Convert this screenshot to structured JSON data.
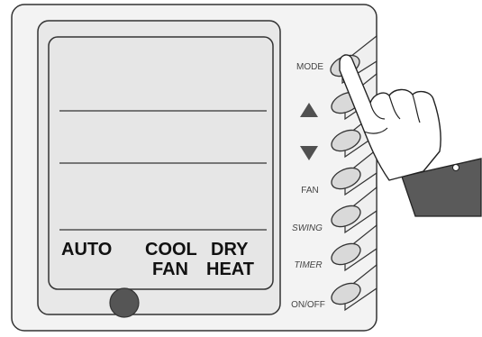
{
  "display": {
    "modes_row1": [
      "AUTO",
      "COOL",
      "DRY"
    ],
    "modes_row2": [
      "FAN",
      "HEAT"
    ]
  },
  "buttons": [
    {
      "id": "mode",
      "label": "MODE"
    },
    {
      "id": "up",
      "label": "",
      "icon": "up-triangle-icon"
    },
    {
      "id": "down",
      "label": "",
      "icon": "down-triangle-icon"
    },
    {
      "id": "fan",
      "label": "FAN"
    },
    {
      "id": "swing",
      "label": "SWING"
    },
    {
      "id": "timer",
      "label": "TIMER"
    },
    {
      "id": "onoff",
      "label": "ON/OFF"
    }
  ],
  "colors": {
    "panel_fill": "#f3f3f3",
    "screen_fill": "#e6e6e6",
    "button_fill": "#d9d9d9",
    "indicator_fill": "#555555",
    "triangle_fill": "#505050",
    "outline": "#333333"
  }
}
